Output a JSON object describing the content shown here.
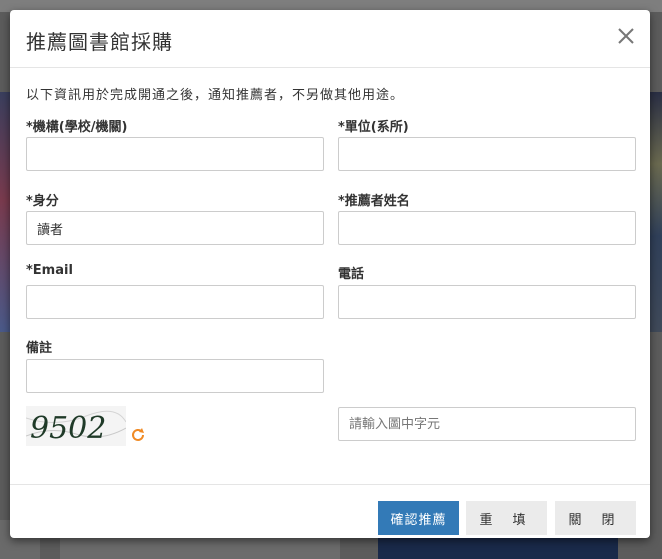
{
  "dialog": {
    "title": "推薦圖書館採購",
    "notice": "以下資訊用於完成開通之後，通知推薦者，不另做其他用途。"
  },
  "form": {
    "institution": {
      "label": "*機構(學校/機關)",
      "value": "",
      "placeholder": ""
    },
    "department": {
      "label": "*單位(系所)",
      "value": "",
      "placeholder": ""
    },
    "identity": {
      "label": "*身分",
      "value": "讀者"
    },
    "recommender_name": {
      "label": "*推薦者姓名",
      "value": "",
      "placeholder": ""
    },
    "email": {
      "label": "*Email",
      "value": "",
      "placeholder": ""
    },
    "phone": {
      "label": "電話",
      "value": "",
      "placeholder": ""
    },
    "remarks": {
      "label": "備註",
      "value": "",
      "placeholder": ""
    },
    "captcha": {
      "image_text": "9502",
      "placeholder": "請輸入圖中字元"
    }
  },
  "footer": {
    "confirm_label": "確認推薦",
    "reset_label": "重填",
    "close_label": "關閉"
  },
  "colors": {
    "primary": "#337ab7",
    "default_btn": "#ebebeb",
    "refresh_icon": "#f08a24"
  },
  "icons": {
    "close": "close-icon",
    "refresh": "refresh-icon"
  }
}
